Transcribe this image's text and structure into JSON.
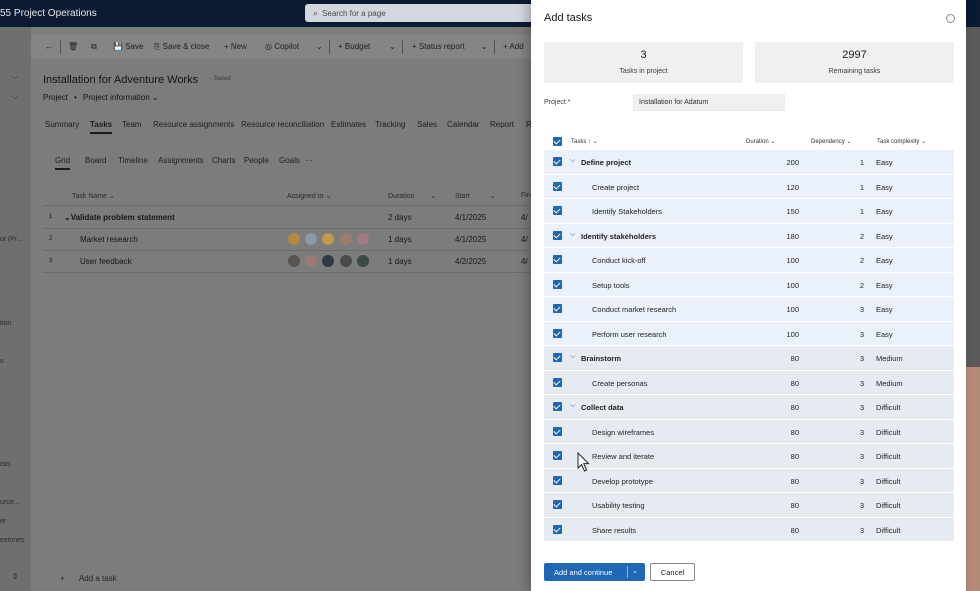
{
  "app": {
    "title": "55 Project Operations",
    "search_placeholder": "Search for a page"
  },
  "leftnav": {
    "items": [
      "ot (Pr...",
      "tion",
      "s",
      "ists",
      "urce...",
      "er",
      "estones"
    ]
  },
  "commandbar": {
    "save": "Save",
    "save_close": "Save & close",
    "new": "New",
    "copilot": "Copilot",
    "budget": "Budget",
    "status_report": "Status report",
    "add": "Add"
  },
  "record": {
    "title": "Installation for Adventure Works",
    "saved": "- Saved",
    "entity": "Project",
    "form": "Project information"
  },
  "main_tabs": [
    "Summary",
    "Tasks",
    "Team",
    "Resource assignments",
    "Resource reconciliation",
    "Estimates",
    "Tracking",
    "Sales",
    "Calendar",
    "Report",
    "R"
  ],
  "view_tabs": [
    "Grid",
    "Board",
    "Timeline",
    "Assignments",
    "Charts",
    "People",
    "Goals"
  ],
  "grid": {
    "headers": {
      "task_name": "Task Name",
      "assigned_to": "Assigned to",
      "duration": "Duration",
      "start": "Start",
      "finish": "Fin"
    },
    "rows": [
      {
        "index": "1",
        "name": "Validate problem statement",
        "duration": "2 days",
        "start": "4/1/2025",
        "finish": "4/"
      },
      {
        "index": "2",
        "name": "Market research",
        "duration": "1 days",
        "start": "4/1/2025",
        "finish": "4/"
      },
      {
        "index": "3",
        "name": "User feedback",
        "duration": "1 days",
        "start": "4/2/2025",
        "finish": "4/"
      }
    ],
    "add_task": "Add a task"
  },
  "panel": {
    "title": "Add tasks",
    "stats": {
      "tasks_in_project": {
        "value": "3",
        "label": "Tasks in project"
      },
      "remaining": {
        "value": "2997",
        "label": "Remaining tasks"
      }
    },
    "project_label": "Project *",
    "project_value": "Installation for Adatum",
    "columns": {
      "tasks": "Tasks",
      "duration": "Duration",
      "dependency": "Dependency",
      "complexity": "Task complexity"
    },
    "rows": [
      {
        "name": "Define project",
        "group": true,
        "duration": "200",
        "dependency": "1",
        "complexity": "Easy"
      },
      {
        "name": "Create project",
        "group": false,
        "duration": "120",
        "dependency": "1",
        "complexity": "Easy"
      },
      {
        "name": "Identify Stakeholders",
        "group": false,
        "duration": "150",
        "dependency": "1",
        "complexity": "Easy"
      },
      {
        "name": "Identify stakeholders",
        "group": true,
        "duration": "180",
        "dependency": "2",
        "complexity": "Easy"
      },
      {
        "name": "Conduct kick-off",
        "group": false,
        "duration": "100",
        "dependency": "2",
        "complexity": "Easy"
      },
      {
        "name": "Setup tools",
        "group": false,
        "duration": "100",
        "dependency": "2",
        "complexity": "Easy"
      },
      {
        "name": "Conduct market research",
        "group": false,
        "duration": "100",
        "dependency": "3",
        "complexity": "Easy"
      },
      {
        "name": "Perform user research",
        "group": false,
        "duration": "100",
        "dependency": "3",
        "complexity": "Easy"
      },
      {
        "name": "Brainstorm",
        "group": true,
        "duration": "80",
        "dependency": "3",
        "complexity": "Medium"
      },
      {
        "name": "Create personas",
        "group": false,
        "duration": "80",
        "dependency": "3",
        "complexity": "Medium"
      },
      {
        "name": "Collect data",
        "group": true,
        "duration": "80",
        "dependency": "3",
        "complexity": "Difficult"
      },
      {
        "name": "Design wireframes",
        "group": false,
        "duration": "80",
        "dependency": "3",
        "complexity": "Difficult"
      },
      {
        "name": "Review and iterate",
        "group": false,
        "duration": "80",
        "dependency": "3",
        "complexity": "Difficult"
      },
      {
        "name": "Develop prototype",
        "group": false,
        "duration": "80",
        "dependency": "3",
        "complexity": "Difficult"
      },
      {
        "name": "Usability testing",
        "group": false,
        "duration": "80",
        "dependency": "3",
        "complexity": "Difficult"
      },
      {
        "name": "Share results",
        "group": false,
        "duration": "80",
        "dependency": "3",
        "complexity": "Difficult"
      }
    ],
    "add_continue": "Add and continue",
    "cancel": "Cancel"
  }
}
